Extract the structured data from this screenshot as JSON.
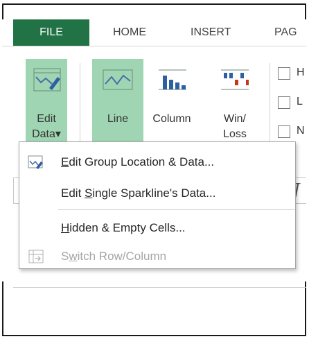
{
  "tabs": {
    "file": "FILE",
    "home": "HOME",
    "insert": "INSERT",
    "page": "PAG"
  },
  "ribbon": {
    "edit_data": {
      "line1": "Edit",
      "line2": "Data",
      "caret": "▾"
    },
    "line": "Line",
    "column": "Column",
    "winloss": {
      "line1": "Win/",
      "line2": "Loss"
    },
    "show_checks": [
      "H",
      "L",
      "N"
    ]
  },
  "menu": {
    "items": [
      {
        "pre": "",
        "u": "E",
        "post": "dit Group Location & Data...",
        "icon": "edit-sparkline-icon",
        "disabled": false
      },
      {
        "pre": "Edit ",
        "u": "S",
        "post": "ingle Sparkline's Data...",
        "icon": "",
        "disabled": false
      },
      {
        "pre": "",
        "u": "H",
        "post": "idden & Empty Cells...",
        "icon": "",
        "disabled": false
      },
      {
        "pre": "S",
        "u": "w",
        "post": "itch Row/Column",
        "icon": "switch-row-column-icon",
        "disabled": true
      }
    ]
  },
  "sheet": {
    "fx": "J"
  },
  "colors": {
    "file_tab": "#217346",
    "selected_button": "#9fd5b2"
  }
}
